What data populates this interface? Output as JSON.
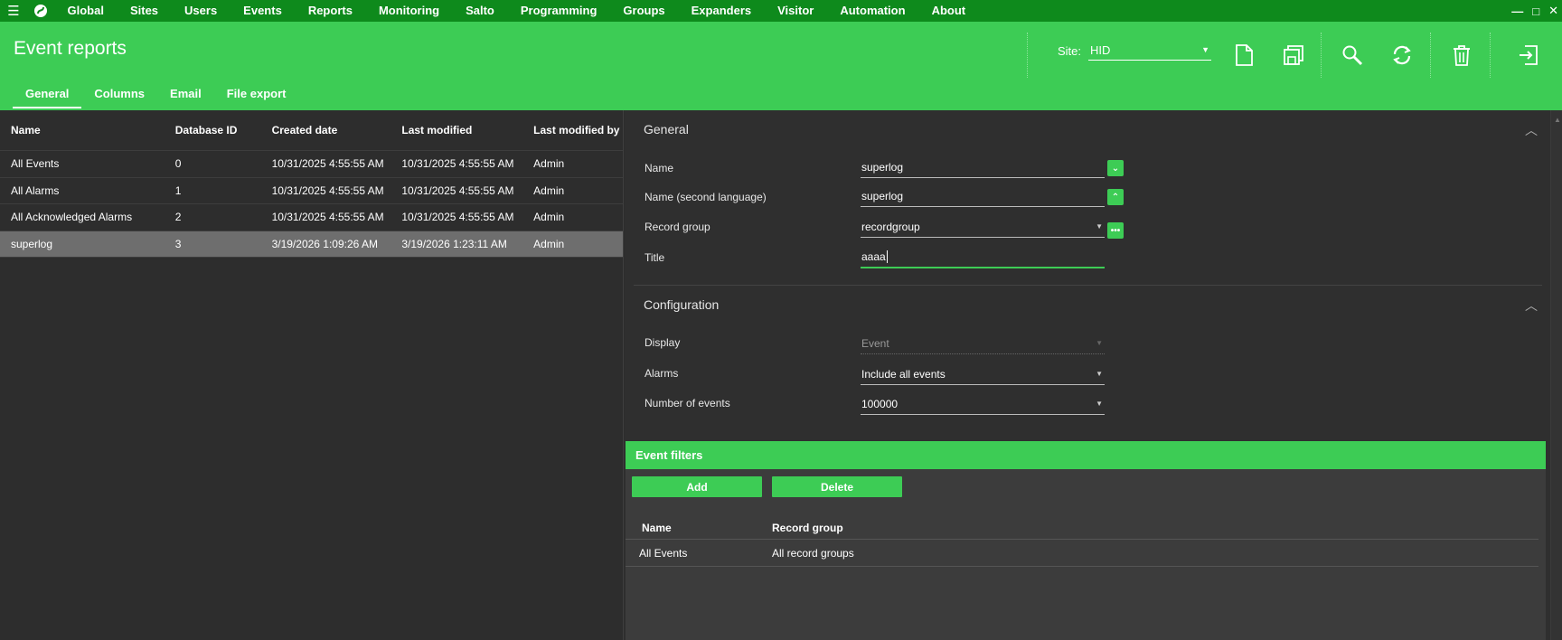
{
  "menu": {
    "items": [
      "Global",
      "Sites",
      "Users",
      "Events",
      "Reports",
      "Monitoring",
      "Salto",
      "Programming",
      "Groups",
      "Expanders",
      "Visitor",
      "Automation",
      "About"
    ]
  },
  "window_controls": {
    "minimize": "—",
    "maximize": "□",
    "close": "✕"
  },
  "header": {
    "title": "Event reports",
    "site_label": "Site:",
    "site_value": "HID",
    "tabs": [
      "General",
      "Columns",
      "Email",
      "File export"
    ],
    "active_tab": "General"
  },
  "reports_table": {
    "columns": [
      "Name",
      "Database ID",
      "Created date",
      "Last modified",
      "Last modified by"
    ],
    "rows": [
      [
        "All Events",
        "0",
        "10/31/2025 4:55:55 AM",
        "10/31/2025 4:55:55 AM",
        "Admin"
      ],
      [
        "All Alarms",
        "1",
        "10/31/2025 4:55:55 AM",
        "10/31/2025 4:55:55 AM",
        "Admin"
      ],
      [
        "All Acknowledged Alarms",
        "2",
        "10/31/2025 4:55:55 AM",
        "10/31/2025 4:55:55 AM",
        "Admin"
      ],
      [
        "superlog",
        "3",
        "3/19/2026 1:09:26 AM",
        "3/19/2026 1:23:11 AM",
        "Admin"
      ]
    ],
    "selected_row": 3
  },
  "general": {
    "title": "General",
    "name_label": "Name",
    "name_value": "superlog",
    "name2_label": "Name (second language)",
    "name2_value": "superlog",
    "record_group_label": "Record group",
    "record_group_value": "recordgroup",
    "title_label": "Title",
    "title_value": "aaaa"
  },
  "configuration": {
    "title": "Configuration",
    "display_label": "Display",
    "display_value": "Event",
    "alarms_label": "Alarms",
    "alarms_value": "Include all events",
    "num_events_label": "Number of events",
    "num_events_value": "100000"
  },
  "event_filters": {
    "title": "Event filters",
    "add_label": "Add",
    "delete_label": "Delete",
    "columns": [
      "Name",
      "Record group"
    ],
    "rows": [
      [
        "All Events",
        "All record groups"
      ]
    ]
  },
  "colors": {
    "accent": "#3dcc55",
    "menubar": "#0e8a1c",
    "background": "#2d2d2d",
    "selected_row": "#6e6e6e"
  }
}
